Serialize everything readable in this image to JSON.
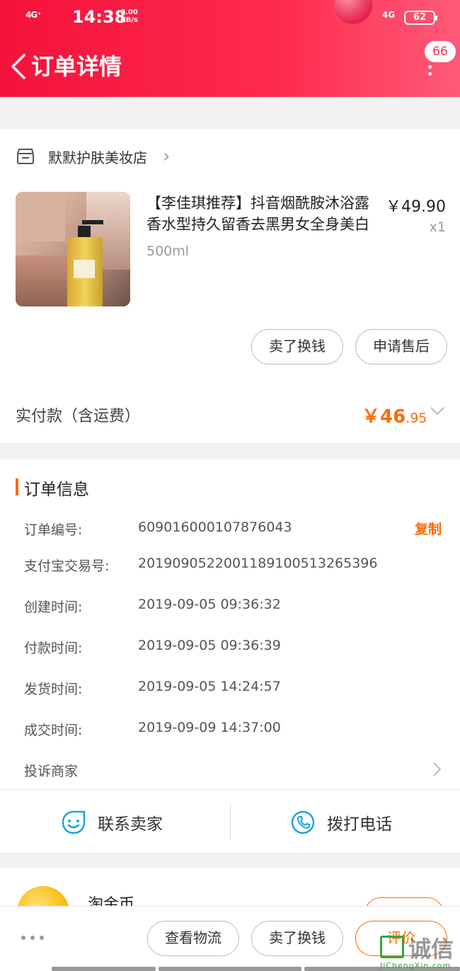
{
  "status_bar": {
    "signal": "4G⁺",
    "time": "14:38",
    "speed_value": "0.00",
    "speed_unit": "KB/s",
    "network2": "4G",
    "battery": "62"
  },
  "header": {
    "title": "订单详情",
    "message_count": "66",
    "accent": "#ff2a4e"
  },
  "shop": {
    "name": "默默护肤美妆店"
  },
  "product": {
    "title": "【李佳琪推荐】抖音烟酰胺沐浴露香水型持久留香去黑男女全身美白",
    "spec": "500ml",
    "price": "￥49.90",
    "quantity": "x1"
  },
  "item_actions": {
    "sell_label": "卖了换钱",
    "aftersale_label": "申请售后"
  },
  "payment": {
    "label": "实付款（含运费）",
    "amount_main": "￥46",
    "amount_decimal": ".95",
    "accent": "#ff6a00"
  },
  "order_info": {
    "section_title": "订单信息",
    "copy_label": "复制",
    "rows": [
      {
        "label": "订单编号:",
        "value": "609016000107876043"
      },
      {
        "label": "支付宝交易号:",
        "value": "2019090522001189100513265396"
      },
      {
        "label": "创建时间:",
        "value": "2019-09-05 09:36:32"
      },
      {
        "label": "付款时间:",
        "value": "2019-09-05 09:36:39"
      },
      {
        "label": "发货时间:",
        "value": "2019-09-05 14:24:57"
      },
      {
        "label": "成交时间:",
        "value": "2019-09-09 14:37:00"
      }
    ],
    "complain_label": "投诉商家"
  },
  "contact": {
    "seller_label": "联系卖家",
    "call_label": "拨打电话"
  },
  "coin": {
    "label": "淘金币"
  },
  "bottom_bar": {
    "logistics_label": "查看物流",
    "sell_label": "卖了换钱",
    "review_label": "评价"
  },
  "watermark": {
    "text": "诚信",
    "url": "JiChengXin.com"
  }
}
